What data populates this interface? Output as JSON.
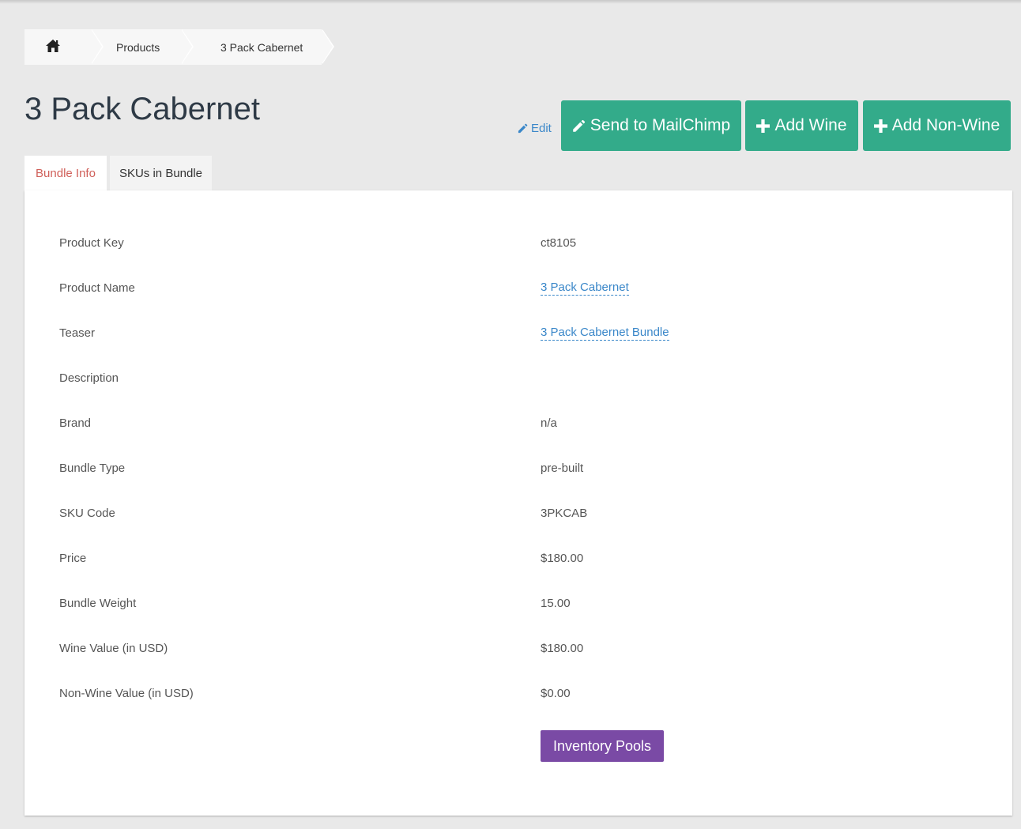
{
  "breadcrumb": {
    "home_icon": "home-icon",
    "products_label": "Products",
    "current_label": "3 Pack Cabernet"
  },
  "page": {
    "title": "3 Pack Cabernet"
  },
  "actions": {
    "edit_label": "Edit",
    "edit_icon": "pencil-icon",
    "mailchimp_label": "Send to MailChimp",
    "add_wine_label": "Add Wine",
    "add_nonwine_label": "Add Non-Wine"
  },
  "tabs": [
    {
      "label": "Bundle Info",
      "active": true
    },
    {
      "label": "SKUs in Bundle",
      "active": false
    }
  ],
  "fields": [
    {
      "label": "Product Key",
      "value": "ct8105"
    },
    {
      "label": "Product Name",
      "value": "3 Pack Cabernet"
    },
    {
      "label": "Teaser",
      "value": "3 Pack Cabernet Bundle"
    },
    {
      "label": "Description",
      "value": ""
    },
    {
      "label": "Brand",
      "value": "n/a"
    },
    {
      "label": "Bundle Type",
      "value": "pre-built"
    },
    {
      "label": "SKU Code",
      "value": "3PKCAB"
    },
    {
      "label": "Price",
      "value": "$180.00"
    },
    {
      "label": "Bundle Weight",
      "value": "15.00"
    },
    {
      "label": "Wine Value (in USD)",
      "value": "$180.00"
    },
    {
      "label": "Non-Wine Value (in USD)",
      "value": "$0.00"
    }
  ],
  "inventory_button_label": "Inventory Pools",
  "colors": {
    "accent_green": "#33ab8a",
    "accent_purple": "#7a4aa5",
    "link_blue": "#3a87c9",
    "active_tab_text": "#d0605a"
  }
}
